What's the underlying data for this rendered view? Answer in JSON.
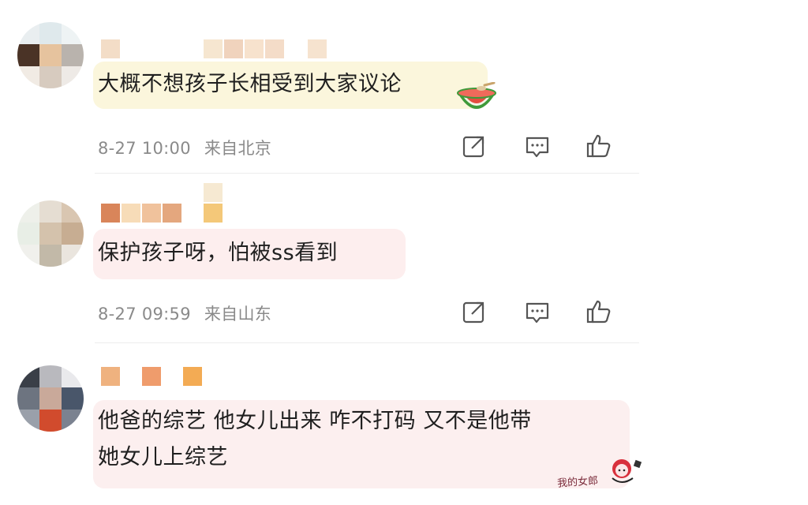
{
  "comments": [
    {
      "text": "大概不想孩子长相受到大家议论",
      "time": "8-27 10:00",
      "location": "来自北京",
      "emoji": "watermelon-emoji"
    },
    {
      "text": "保护孩子呀，怕被ss看到",
      "time": "8-27 09:59",
      "location": "来自山东"
    },
    {
      "text_line1": "他爸的综艺 他女儿出来 咋不打码 又不是他带",
      "text_line2": "她女儿上综艺"
    }
  ],
  "actions": {
    "share": "share-icon",
    "reply": "comment-icon",
    "like": "thumbs-up-icon"
  },
  "watermark": "我的女郎",
  "colors": {
    "meta": "#8a8a8a",
    "bubble_1": "#fbf6dc",
    "bubble_2": "#fdeeee",
    "bubble_3": "#fcefef"
  }
}
